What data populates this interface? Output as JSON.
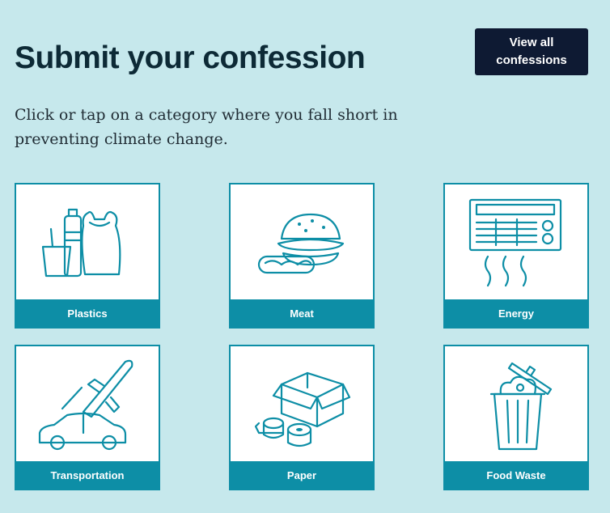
{
  "page": {
    "title": "Submit your confession",
    "view_all_label": "View all confessions",
    "intro": "Click or tap on a category where you fall short in preventing climate change."
  },
  "categories": [
    {
      "label": "Plastics",
      "icon": "plastics-icon"
    },
    {
      "label": "Meat",
      "icon": "meat-icon"
    },
    {
      "label": "Energy",
      "icon": "energy-icon"
    },
    {
      "label": "Transportation",
      "icon": "transportation-icon"
    },
    {
      "label": "Paper",
      "icon": "paper-icon"
    },
    {
      "label": "Food Waste",
      "icon": "food-waste-icon"
    }
  ],
  "colors": {
    "background": "#c6e8ec",
    "accent": "#0d8ea6",
    "button": "#0e1a33",
    "title": "#0d2a36"
  }
}
